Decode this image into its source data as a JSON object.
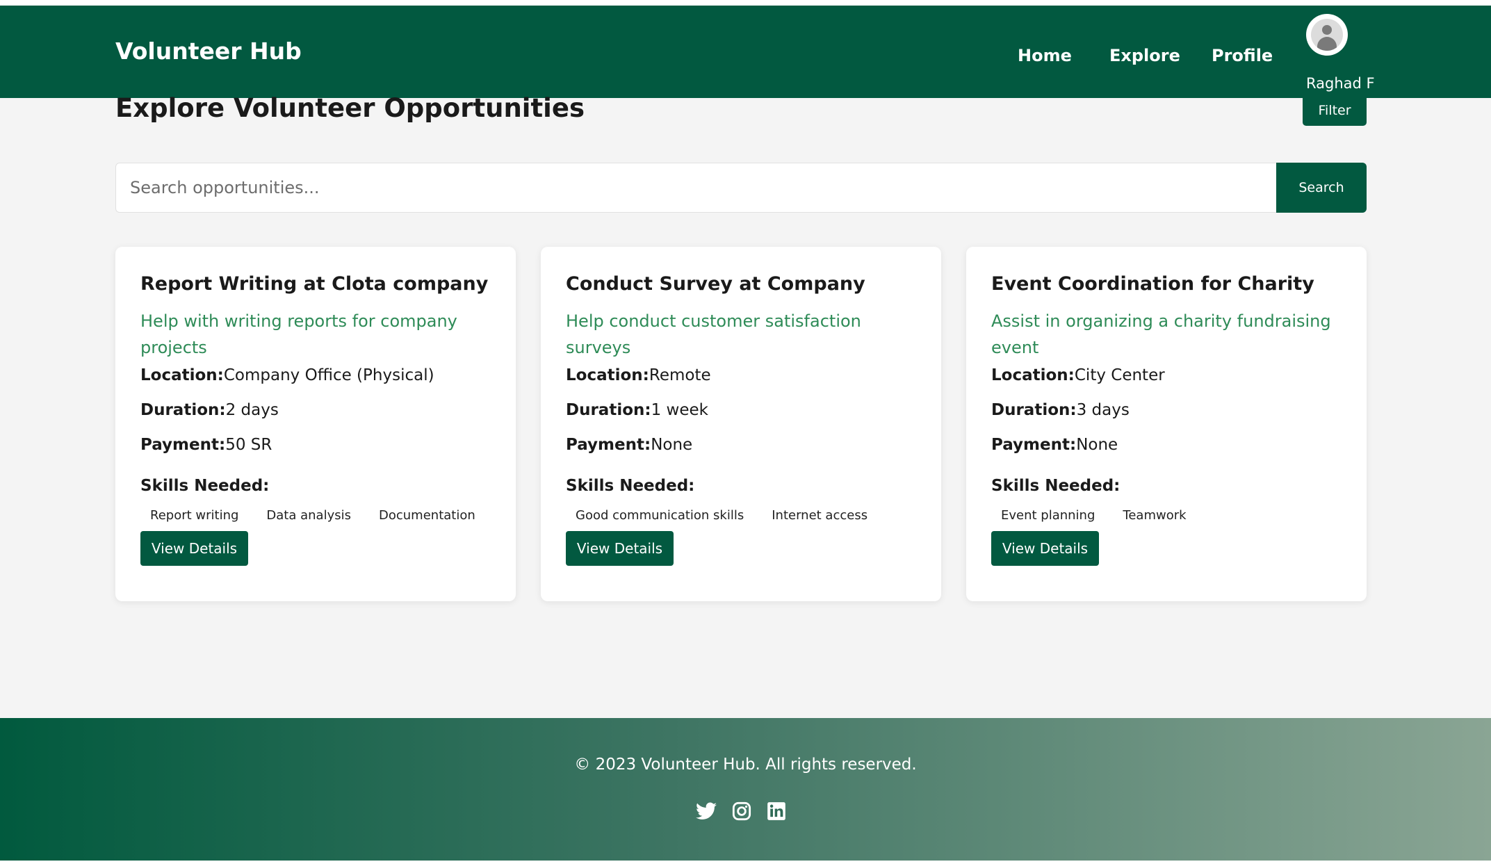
{
  "header": {
    "brand": "Volunteer Hub",
    "nav": [
      "Home",
      "Explore",
      "Profile"
    ],
    "user_name": "Raghad F"
  },
  "main": {
    "title": "Explore Volunteer Opportunities",
    "filter_label": "Filter",
    "search": {
      "placeholder": "Search opportunities...",
      "button_label": "Search"
    }
  },
  "labels": {
    "location": "Location:",
    "duration": "Duration:",
    "payment": "Payment:",
    "skills_needed": "Skills Needed:",
    "view_details": "View Details"
  },
  "opportunities": [
    {
      "title": "Report Writing at Clota company",
      "description": "Help with writing reports for company projects",
      "location": "Company Office (Physical)",
      "duration": "2 days",
      "payment": "50 SR",
      "skills": [
        "Report writing",
        "Data analysis",
        "Documentation"
      ]
    },
    {
      "title": "Conduct Survey at Company",
      "description": "Help conduct customer satisfaction surveys",
      "location": "Remote",
      "duration": "1 week",
      "payment": "None",
      "skills": [
        "Good communication skills",
        "Internet access"
      ]
    },
    {
      "title": "Event Coordination for Charity",
      "description": "Assist in organizing a charity fundraising event",
      "location": "City Center",
      "duration": "3 days",
      "payment": "None",
      "skills": [
        "Event planning",
        "Teamwork"
      ]
    }
  ],
  "footer": {
    "copyright": "© 2023 Volunteer Hub. All rights reserved.",
    "social_icons": [
      "twitter-icon",
      "instagram-icon",
      "linkedin-icon"
    ]
  },
  "colors": {
    "primary": "#025940",
    "accent_text": "#2e8b57",
    "background": "#f4f4f4"
  }
}
